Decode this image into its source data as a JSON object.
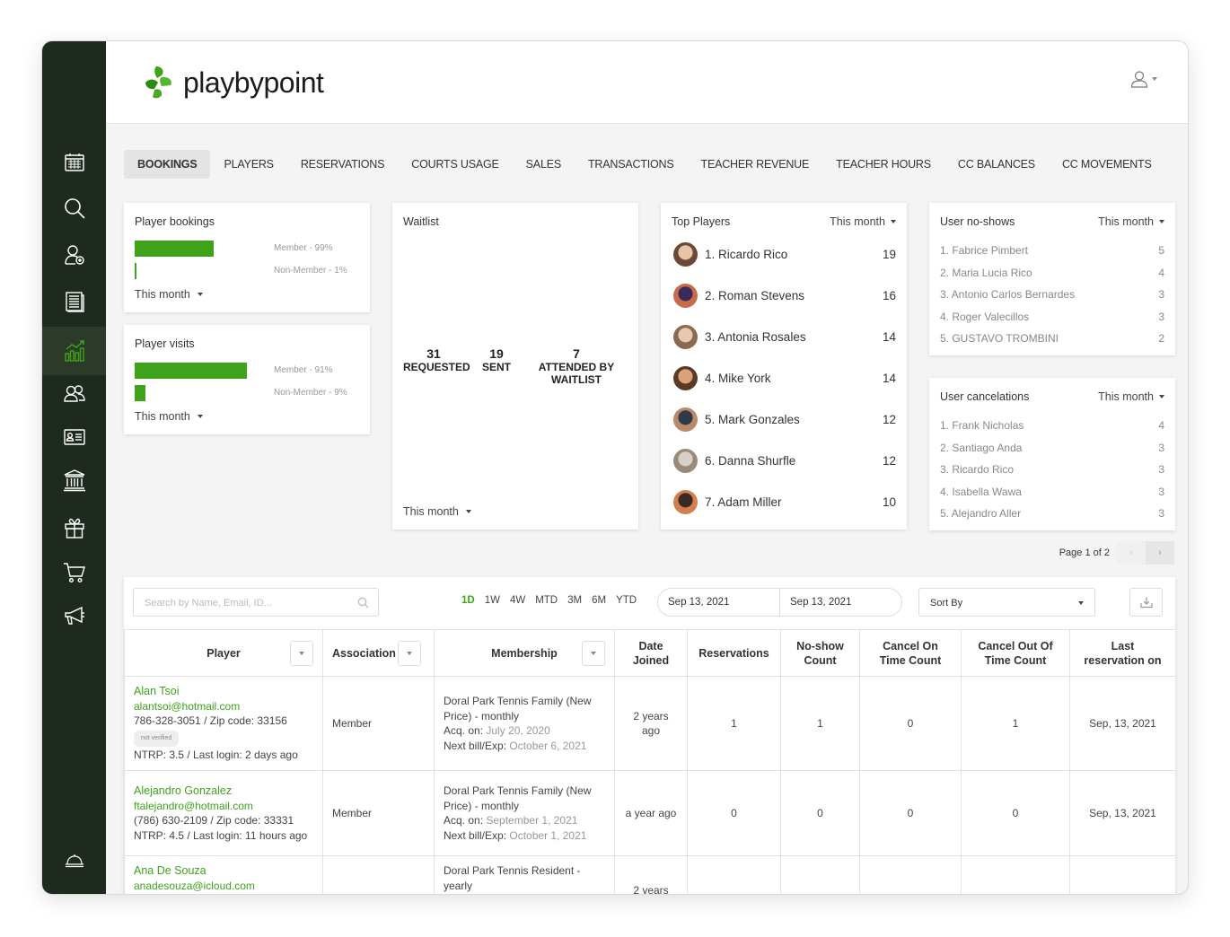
{
  "brand": {
    "name": "playbypoint",
    "accent": "#3ea31b",
    "sidebar_bg": "#1f2a1e"
  },
  "sidebar": {
    "icons": [
      "calendar-icon",
      "search-icon",
      "add-user-icon",
      "newspaper-icon",
      "analytics-icon",
      "users-icon",
      "id-card-icon",
      "bank-icon",
      "gift-icon",
      "cart-icon",
      "megaphone-icon",
      "service-bell-icon"
    ],
    "active": "analytics-icon"
  },
  "tabs": [
    "BOOKINGS",
    "PLAYERS",
    "RESERVATIONS",
    "COURTS USAGE",
    "SALES",
    "TRANSACTIONS",
    "TEACHER REVENUE",
    "TEACHER HOURS",
    "CC BALANCES",
    "CC MOVEMENTS"
  ],
  "player_bookings": {
    "title": "Player bookings",
    "member_label": "Member - 99%",
    "member_pct": 99,
    "nonmember_label": "Non-Member - 1%",
    "nonmember_pct": 1,
    "filter": "This month"
  },
  "player_visits": {
    "title": "Player visits",
    "member_label": "Member - 91%",
    "member_pct": 91,
    "nonmember_label": "Non-Member - 9%",
    "nonmember_pct": 9,
    "filter": "This month"
  },
  "waitlist": {
    "title": "Waitlist",
    "requested_num": "31",
    "requested_label": "REQUESTED",
    "sent_num": "19",
    "sent_label": "SENT",
    "attended_num": "7",
    "attended_label_1": "ATTENDED BY",
    "attended_label_2": "WAITLIST",
    "filter": "This month"
  },
  "top_players": {
    "title": "Top Players",
    "filter": "This month",
    "items": [
      {
        "name": "1. Ricardo Rico",
        "count": "19"
      },
      {
        "name": "2. Roman Stevens",
        "count": "16"
      },
      {
        "name": "3. Antonia Rosales",
        "count": "14"
      },
      {
        "name": "4. Mike York",
        "count": "14"
      },
      {
        "name": "5. Mark Gonzales",
        "count": "12"
      },
      {
        "name": "6. Danna Shurfle",
        "count": "12"
      },
      {
        "name": "7. Adam Miller",
        "count": "10"
      }
    ]
  },
  "no_shows": {
    "title": "User no-shows",
    "filter": "This month",
    "items": [
      {
        "name": "1. Fabrice Pimbert",
        "count": "5"
      },
      {
        "name": "2. Maria Lucia Rico",
        "count": "4"
      },
      {
        "name": "3. Antonio Carlos Bernardes",
        "count": "3"
      },
      {
        "name": "4. Roger Valecillos",
        "count": "3"
      },
      {
        "name": "5. GUSTAVO TROMBINI",
        "count": "2"
      }
    ]
  },
  "cancellations": {
    "title": "User cancelations",
    "filter": "This month",
    "items": [
      {
        "name": "1. Frank Nicholas",
        "count": "4"
      },
      {
        "name": "2. Santiago Anda",
        "count": "3"
      },
      {
        "name": "3. Ricardo Rico",
        "count": "3"
      },
      {
        "name": "4. Isabella Wawa",
        "count": "3"
      },
      {
        "name": "5. Alejandro Aller",
        "count": "3"
      }
    ]
  },
  "pager": {
    "label": "Page 1 of 2",
    "prev": "‹",
    "next": "›"
  },
  "table_controls": {
    "search_placeholder": "Search by Name, Email, ID...",
    "ranges": [
      "1D",
      "1W",
      "4W",
      "MTD",
      "3M",
      "6M",
      "YTD"
    ],
    "active_range": "1D",
    "date_from": "Sep 13, 2021",
    "date_to": "Sep 13, 2021",
    "sort_label": "Sort By"
  },
  "columns": {
    "player": "Player",
    "association": "Association",
    "membership": "Membership",
    "date_joined_1": "Date",
    "date_joined_2": "Joined",
    "reservations": "Reservations",
    "noshow_1": "No-show",
    "noshow_2": "Count",
    "cancel_on_1": "Cancel On",
    "cancel_on_2": "Time Count",
    "cancel_out_1": "Cancel Out Of",
    "cancel_out_2": "Time Count",
    "last_1": "Last",
    "last_2": "reservation on"
  },
  "rows": [
    {
      "name": "Alan Tsoi",
      "email": "alantsoi@hotmail.com",
      "phone": "786-328-3051 / Zip code: 33156",
      "badge": "not verified",
      "ntrp": "NTRP: 3.5 / Last login: 2 days ago",
      "association": "Member",
      "membership_1": "Doral Park Tennis Family (New",
      "membership_2": "Price) - monthly",
      "acq_label": "Acq. on:",
      "acq": "July 20, 2020",
      "bill_label": "Next bill/Exp:",
      "bill": "October 6, 2021",
      "joined_1": "2 years",
      "joined_2": "ago",
      "reservations": "1",
      "noshow": "1",
      "cancel_on": "0",
      "cancel_out": "1",
      "last": "Sep, 13, 2021"
    },
    {
      "name": "Alejandro Gonzalez",
      "email": "ftalejandro@hotmail.com",
      "phone": "(786) 630-2109 / Zip code: 33331",
      "ntrp": "NTRP: 4.5 / Last login: 11 hours ago",
      "association": "Member",
      "membership_1": "Doral Park Tennis Family (New",
      "membership_2": "Price) - monthly",
      "acq_label": "Acq. on:",
      "acq": "September 1, 2021",
      "bill_label": "Next bill/Exp:",
      "bill": "October 1, 2021",
      "joined_1": "a year ago",
      "reservations": "0",
      "noshow": "0",
      "cancel_on": "0",
      "cancel_out": "0",
      "last": "Sep, 13, 2021"
    },
    {
      "name": "Ana De Souza",
      "email": "anadesouza@icloud.com",
      "membership_1": "Doral Park Tennis Resident -",
      "membership_2": "yearly",
      "joined_1": "2 years"
    }
  ]
}
